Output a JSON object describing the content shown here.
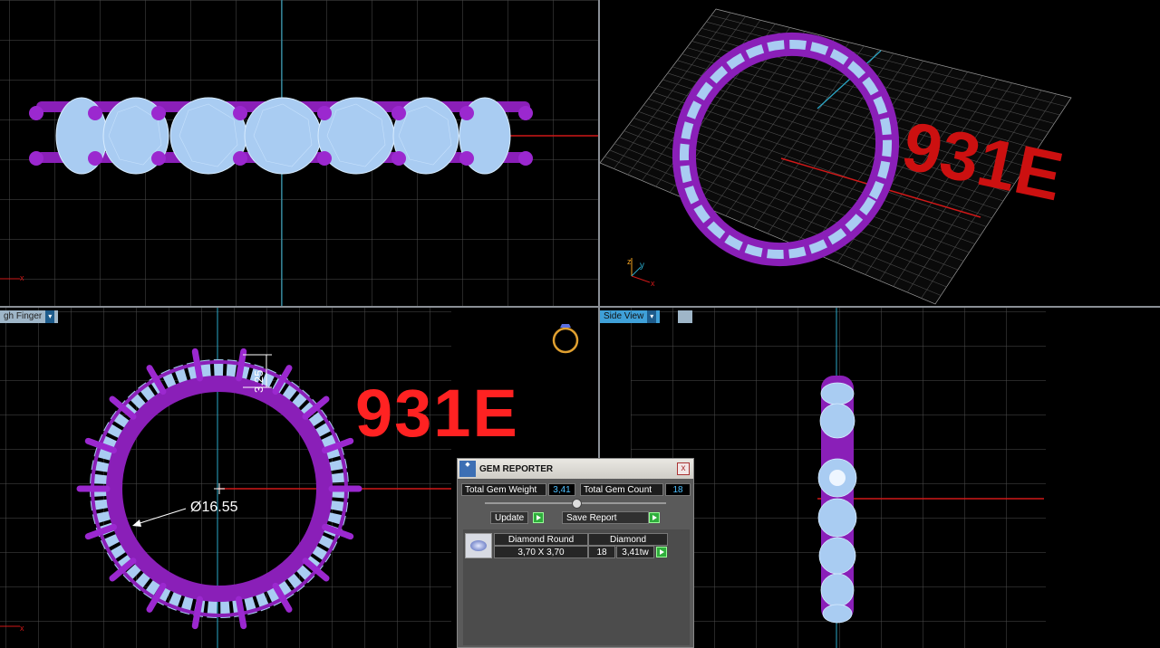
{
  "viewports": {
    "bottom_left": {
      "tab_label": "gh Finger",
      "diameter_label": "Ø16.55",
      "dim_label": "3.25"
    },
    "bottom_right": {
      "tab_label": "Side View"
    },
    "top_right": {
      "axis_z": "z",
      "axis_y": "y",
      "axis_x": "x"
    },
    "top_left": {
      "axis_x": "x"
    },
    "bl_axis_x": "x"
  },
  "stamp": {
    "top_right": "931E",
    "bottom_left": "931E"
  },
  "gem_reporter": {
    "title": "GEM REPORTER",
    "close": "x",
    "total_weight_label": "Total Gem Weight",
    "total_weight_value": "3,41",
    "total_count_label": "Total Gem Count",
    "total_count_value": "18",
    "update_label": "Update",
    "save_report_label": "Save Report",
    "row": {
      "shape": "Diamond Round",
      "material": "Diamond",
      "size": "3,70 X 3,70",
      "count": "18",
      "weight": "3,41tw"
    }
  },
  "colors": {
    "gem": "#a9ccf2",
    "metal": "#8a1fb8",
    "stamp": "#ff2222",
    "grid": "#5a5a5a",
    "axis_red": "#d01818",
    "axis_cyan": "#2aa8c8"
  },
  "icons": [
    "ring-icon",
    "gem-reporter-logo-icon",
    "close-icon",
    "update-go-icon",
    "save-go-icon",
    "dropdown-icon",
    "diamond-thumbnail-icon"
  ]
}
